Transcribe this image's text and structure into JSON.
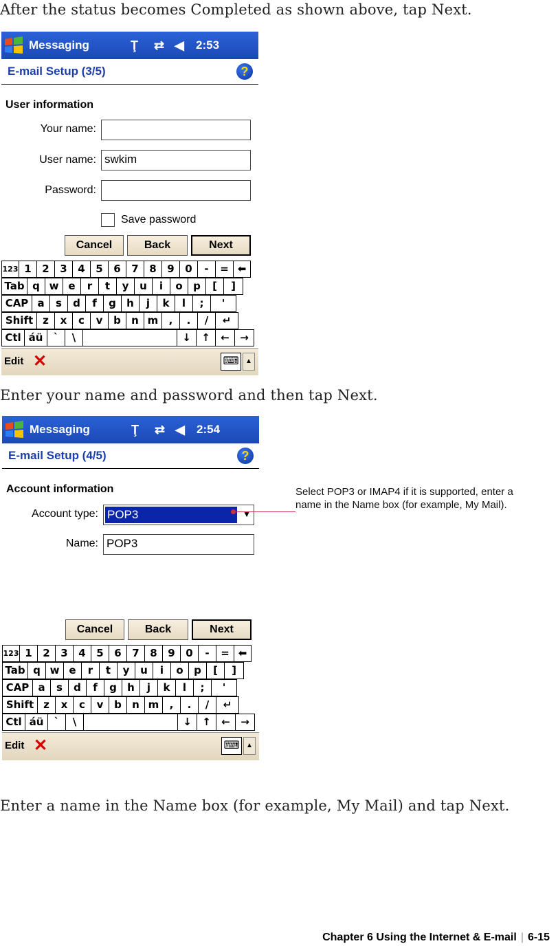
{
  "captions": {
    "top": "After the status becomes Completed as shown above, tap Next.",
    "middle": "Enter your name and password and then tap Next.",
    "bottom": "Enter a name in the Name box (for example, My Mail) and tap Next."
  },
  "screen1": {
    "app_title": "Messaging",
    "time": "2:53",
    "header": "E-mail Setup (3/5)",
    "section": "User information",
    "your_name_label": "Your name:",
    "your_name_value": "",
    "user_name_label": "User name:",
    "user_name_value": "swkim",
    "password_label": "Password:",
    "password_value": "",
    "save_password_label": "Save password",
    "save_password_checked": false,
    "cancel": "Cancel",
    "back": "Back",
    "next": "Next",
    "menu_edit": "Edit"
  },
  "screen2": {
    "app_title": "Messaging",
    "time": "2:54",
    "header": "E-mail Setup (4/5)",
    "section": "Account information",
    "account_type_label": "Account type:",
    "account_type_value": "POP3",
    "name_label": "Name:",
    "name_value": "POP3",
    "cancel": "Cancel",
    "back": "Back",
    "next": "Next",
    "menu_edit": "Edit"
  },
  "callout": "Select POP3 or IMAP4 if it is supported, enter a name in the Name box (for example, My Mail).",
  "keyboard": {
    "row1": [
      "123",
      "1",
      "2",
      "3",
      "4",
      "5",
      "6",
      "7",
      "8",
      "9",
      "0",
      "-",
      "=",
      "⬅"
    ],
    "row2": [
      "Tab",
      "q",
      "w",
      "e",
      "r",
      "t",
      "y",
      "u",
      "i",
      "o",
      "p",
      "[",
      "]"
    ],
    "row3": [
      "CAP",
      "a",
      "s",
      "d",
      "f",
      "g",
      "h",
      "j",
      "k",
      "l",
      ";",
      "'"
    ],
    "row4": [
      "Shift",
      "z",
      "x",
      "c",
      "v",
      "b",
      "n",
      "m",
      ",",
      ".",
      "/",
      "↵"
    ],
    "row5": [
      "Ctl",
      "áü",
      "`",
      "\\",
      "",
      "↓",
      "↑",
      "←",
      "→"
    ]
  },
  "footer": {
    "chapter": "Chapter 6 Using the Internet & E-mail",
    "page": "6-15"
  },
  "colors": {
    "titlebar": "#1c48b6",
    "header_text": "#1b3ea8",
    "selection": "#0a25a8",
    "callout_line": "#c8304a"
  }
}
